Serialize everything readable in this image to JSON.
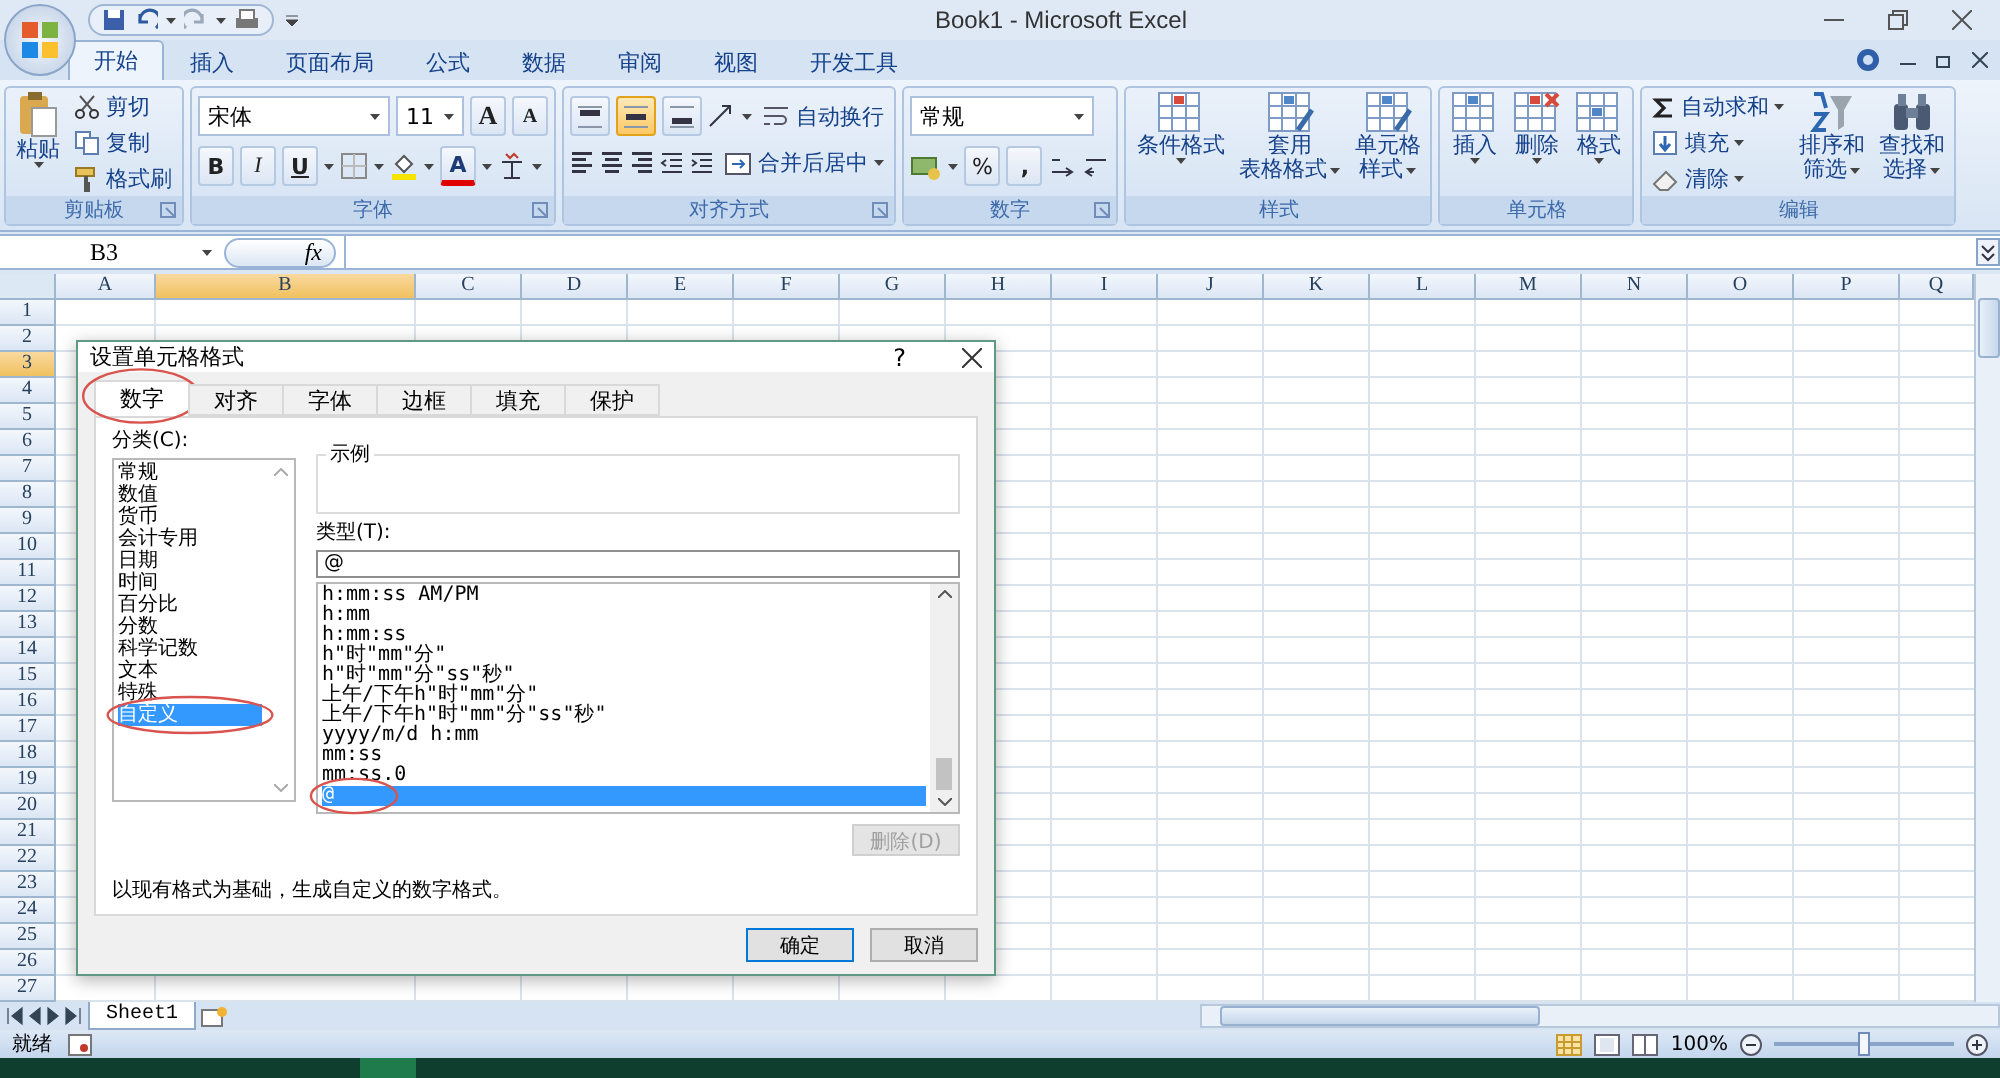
{
  "window": {
    "title": "Book1 - Microsoft Excel"
  },
  "ribbon_tabs": [
    {
      "label": "开始",
      "selected": true
    },
    {
      "label": "插入",
      "selected": false
    },
    {
      "label": "页面布局",
      "selected": false
    },
    {
      "label": "公式",
      "selected": false
    },
    {
      "label": "数据",
      "selected": false
    },
    {
      "label": "审阅",
      "selected": false
    },
    {
      "label": "视图",
      "selected": false
    },
    {
      "label": "开发工具",
      "selected": false
    }
  ],
  "ribbon_groups": [
    {
      "label": "剪贴板",
      "kind": "buttons",
      "launcher": true,
      "items": [
        {
          "kind": "large",
          "lines": [
            "粘贴"
          ],
          "menu": true
        },
        {
          "kind": "small",
          "label": "剪切",
          "menu": false
        },
        {
          "kind": "small",
          "label": "复制",
          "menu": false
        },
        {
          "kind": "small",
          "label": "格式刷",
          "menu": false
        }
      ]
    },
    {
      "label": "字体",
      "kind": "font",
      "launcher": true,
      "font_name": "宋体",
      "font_size": "11",
      "grow": "A",
      "shrink": "A",
      "bold": "B",
      "italic": "I",
      "underline": "U",
      "font_color": "A"
    },
    {
      "label": "对齐方式",
      "kind": "alignment",
      "launcher": true,
      "vertical_align": [
        {
          "selected": false
        },
        {
          "selected": true
        },
        {
          "selected": false
        }
      ],
      "wrap_text": "自动换行",
      "merge_center": "合并后居中"
    },
    {
      "label": "数字",
      "kind": "number",
      "launcher": true,
      "format": "常规",
      "percent": "%",
      "comma": ","
    },
    {
      "label": "样式",
      "kind": "buttons",
      "launcher": false,
      "items": [
        {
          "kind": "large",
          "lines": [
            "条件格式"
          ],
          "menu": true
        },
        {
          "kind": "large",
          "lines": [
            "套用",
            "表格格式"
          ],
          "menu": true
        },
        {
          "kind": "large",
          "lines": [
            "单元格",
            "样式"
          ],
          "menu": true
        }
      ]
    },
    {
      "label": "单元格",
      "kind": "buttons",
      "launcher": false,
      "items": [
        {
          "kind": "large",
          "lines": [
            "插入"
          ],
          "menu": true
        },
        {
          "kind": "large",
          "lines": [
            "删除"
          ],
          "menu": true
        },
        {
          "kind": "large",
          "lines": [
            "格式"
          ],
          "menu": true
        }
      ]
    },
    {
      "label": "编辑",
      "kind": "buttons",
      "launcher": false,
      "items": [
        {
          "kind": "small",
          "label": "自动求和",
          "menu": true
        },
        {
          "kind": "small",
          "label": "填充",
          "menu": true
        },
        {
          "kind": "small",
          "label": "清除",
          "menu": true
        },
        {
          "kind": "large",
          "lines": [
            "排序和",
            "筛选"
          ],
          "menu": true
        },
        {
          "kind": "large",
          "lines": [
            "查找和",
            "选择"
          ],
          "menu": true
        }
      ]
    }
  ],
  "formula_bar": {
    "name_box": "B3",
    "function_label": "fx"
  },
  "columns": [
    {
      "label": "A",
      "selected": false
    },
    {
      "label": "B",
      "selected": true
    },
    {
      "label": "C",
      "selected": false
    },
    {
      "label": "D",
      "selected": false
    },
    {
      "label": "E",
      "selected": false
    },
    {
      "label": "F",
      "selected": false
    },
    {
      "label": "G",
      "selected": false
    },
    {
      "label": "H",
      "selected": false
    },
    {
      "label": "I",
      "selected": false
    },
    {
      "label": "J",
      "selected": false
    },
    {
      "label": "K",
      "selected": false
    },
    {
      "label": "L",
      "selected": false
    },
    {
      "label": "M",
      "selected": false
    },
    {
      "label": "N",
      "selected": false
    },
    {
      "label": "O",
      "selected": false
    },
    {
      "label": "P",
      "selected": false
    },
    {
      "label": "Q",
      "selected": false
    }
  ],
  "rows": [
    {
      "label": "1",
      "selected": false
    },
    {
      "label": "2",
      "selected": false
    },
    {
      "label": "3",
      "selected": true
    },
    {
      "label": "4",
      "selected": false
    },
    {
      "label": "5",
      "selected": false
    },
    {
      "label": "6",
      "selected": false
    },
    {
      "label": "7",
      "selected": false
    },
    {
      "label": "8",
      "selected": false
    },
    {
      "label": "9",
      "selected": false
    },
    {
      "label": "10",
      "selected": false
    },
    {
      "label": "11",
      "selected": false
    },
    {
      "label": "12",
      "selected": false
    },
    {
      "label": "13",
      "selected": false
    },
    {
      "label": "14",
      "selected": false
    },
    {
      "label": "15",
      "selected": false
    },
    {
      "label": "16",
      "selected": false
    },
    {
      "label": "17",
      "selected": false
    },
    {
      "label": "18",
      "selected": false
    },
    {
      "label": "19",
      "selected": false
    },
    {
      "label": "20",
      "selected": false
    },
    {
      "label": "21",
      "selected": false
    },
    {
      "label": "22",
      "selected": false
    },
    {
      "label": "23",
      "selected": false
    },
    {
      "label": "24",
      "selected": false
    },
    {
      "label": "25",
      "selected": false
    },
    {
      "label": "26",
      "selected": false
    },
    {
      "label": "27",
      "selected": false
    }
  ],
  "dialog": {
    "title": "设置单元格格式",
    "help": "?",
    "tabs": [
      {
        "label": "数字",
        "selected": true,
        "circled": true
      },
      {
        "label": "对齐",
        "selected": false,
        "circled": false
      },
      {
        "label": "字体",
        "selected": false,
        "circled": false
      },
      {
        "label": "边框",
        "selected": false,
        "circled": false
      },
      {
        "label": "填充",
        "selected": false,
        "circled": false
      },
      {
        "label": "保护",
        "selected": false,
        "circled": false
      }
    ],
    "category_label": "分类(C):",
    "categories": [
      {
        "label": "常规",
        "selected": false,
        "circled": false
      },
      {
        "label": "数值",
        "selected": false,
        "circled": false
      },
      {
        "label": "货币",
        "selected": false,
        "circled": false
      },
      {
        "label": "会计专用",
        "selected": false,
        "circled": false
      },
      {
        "label": "日期",
        "selected": false,
        "circled": false
      },
      {
        "label": "时间",
        "selected": false,
        "circled": false
      },
      {
        "label": "百分比",
        "selected": false,
        "circled": false
      },
      {
        "label": "分数",
        "selected": false,
        "circled": false
      },
      {
        "label": "科学记数",
        "selected": false,
        "circled": false
      },
      {
        "label": "文本",
        "selected": false,
        "circled": false
      },
      {
        "label": "特殊",
        "selected": false,
        "circled": false
      },
      {
        "label": "自定义",
        "selected": true,
        "circled": true
      }
    ],
    "sample_label": "示例",
    "type_label": "类型(T):",
    "type_value": "@",
    "formats": [
      {
        "label": "h:mm:ss AM/PM",
        "selected": false,
        "circled": false
      },
      {
        "label": "h:mm",
        "selected": false,
        "circled": false
      },
      {
        "label": "h:mm:ss",
        "selected": false,
        "circled": false
      },
      {
        "label": "h\"时\"mm\"分\"",
        "selected": false,
        "circled": false
      },
      {
        "label": "h\"时\"mm\"分\"ss\"秒\"",
        "selected": false,
        "circled": false
      },
      {
        "label": "上午/下午h\"时\"mm\"分\"",
        "selected": false,
        "circled": false
      },
      {
        "label": "上午/下午h\"时\"mm\"分\"ss\"秒\"",
        "selected": false,
        "circled": false
      },
      {
        "label": "yyyy/m/d h:mm",
        "selected": false,
        "circled": false
      },
      {
        "label": "mm:ss",
        "selected": false,
        "circled": false
      },
      {
        "label": "mm:ss.0",
        "selected": false,
        "circled": false
      },
      {
        "label": "@",
        "selected": true,
        "circled": true
      }
    ],
    "delete_button": {
      "label": "删除(D)",
      "disabled": true
    },
    "description": "以现有格式为基础，生成自定义的数字格式。",
    "ok": "确定",
    "cancel": "取消"
  },
  "sheet_tabs": [
    {
      "label": "Sheet1",
      "selected": true
    }
  ],
  "status_bar": {
    "status": "就绪",
    "zoom": {
      "reading": "100%",
      "level": 0.5
    }
  }
}
